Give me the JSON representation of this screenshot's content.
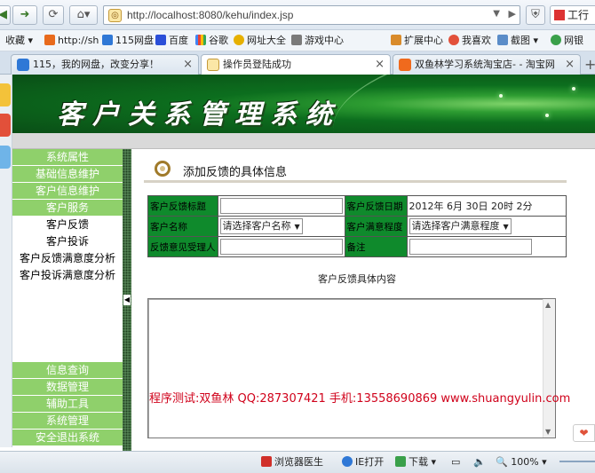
{
  "browser": {
    "url": "http://localhost:8080/kehu/index.jsp",
    "right_button": "工行",
    "favorites": [
      {
        "label": "收藏",
        "icon": "star-icon",
        "has_menu": true
      },
      {
        "label": "http://sh",
        "icon": "site-icon"
      },
      {
        "label": "115网盘",
        "icon": "cloud-icon"
      },
      {
        "label": "百度",
        "icon": "baidu-icon"
      },
      {
        "label": "谷歌",
        "icon": "google-icon"
      },
      {
        "label": "网址大全",
        "icon": "globe-icon"
      },
      {
        "label": "游戏中心",
        "icon": "gamepad-icon"
      }
    ],
    "toolbar_right": [
      {
        "label": "扩展中心",
        "icon": "puzzle-icon"
      },
      {
        "label": "我喜欢",
        "icon": "heart-icon"
      },
      {
        "label": "截图",
        "icon": "scissors-icon"
      },
      {
        "label": "网银",
        "icon": "bank-icon"
      }
    ],
    "tabs": [
      {
        "label": "115，我的网盘，改变分享！",
        "active": false
      },
      {
        "label": "操作员登陆成功",
        "active": true
      },
      {
        "label": "双鱼林学习系统淘宝店- - 淘宝网",
        "active": false
      }
    ]
  },
  "banner": {
    "title": "客户关系管理系统"
  },
  "menu": {
    "top": [
      {
        "label": "系统属性",
        "type": "category"
      },
      {
        "label": "基础信息维护",
        "type": "category"
      },
      {
        "label": "客户信息维护",
        "type": "category"
      },
      {
        "label": "客户服务",
        "type": "category"
      },
      {
        "label": "客户反馈",
        "type": "item"
      },
      {
        "label": "客户投诉",
        "type": "item"
      },
      {
        "label": "客户反馈满意度分析",
        "type": "item"
      },
      {
        "label": "客户投诉满意度分析",
        "type": "item"
      }
    ],
    "bottom": [
      {
        "label": "信息查询"
      },
      {
        "label": "数据管理"
      },
      {
        "label": "辅助工具"
      },
      {
        "label": "系统管理"
      },
      {
        "label": "安全退出系统"
      }
    ]
  },
  "page": {
    "section_title": "添加反馈的具体信息",
    "form": {
      "title_label": "客户反馈标题",
      "title_value": "",
      "date_label": "客户反馈日期",
      "date_value": "2012年 6月 30日 20时 2分",
      "customer_label": "客户名称",
      "customer_select": "请选择客户名称",
      "satisfaction_label": "客户满意程度",
      "satisfaction_select": "请选择客户满意程度",
      "handler_label": "反馈意见受理人",
      "handler_value": "",
      "remark_label": "备注",
      "remark_value": ""
    },
    "content_label": "客户反馈具体内容",
    "content_value": "",
    "watermark": "程序测试:双鱼林 QQ:287307421 手机:13558690869 www.shuangyulin.com"
  },
  "status_bar": {
    "items": [
      {
        "label": "浏览器医生",
        "icon": "doctor-icon"
      },
      {
        "label": "IE打开",
        "icon": "ie-icon"
      },
      {
        "label": "下载",
        "icon": "download-icon"
      },
      {
        "label": "100%",
        "icon": "zoom-icon"
      }
    ]
  },
  "colors": {
    "menu_green": "#8fd06b",
    "label_green": "#0f8a2c",
    "banner_green": "#0c6e1e",
    "watermark_red": "#d0021b"
  }
}
